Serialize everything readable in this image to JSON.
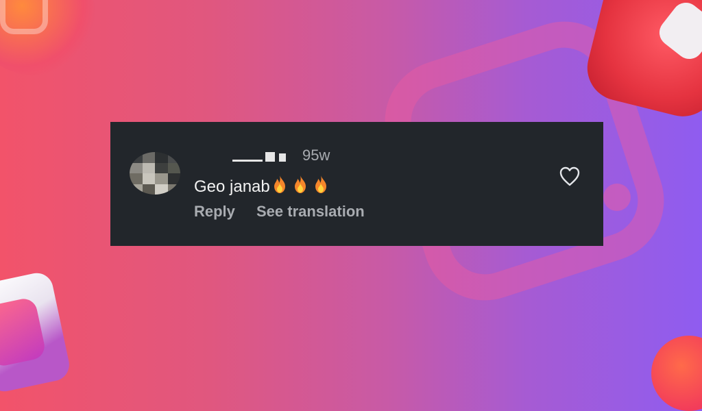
{
  "comment": {
    "username_blurred": true,
    "timestamp": "95w",
    "text": "Geo janab",
    "emojis": [
      "fire-icon",
      "fire-icon",
      "fire-icon"
    ],
    "reply_label": "Reply",
    "translate_label": "See translation",
    "like_icon": "heart-outline-icon"
  },
  "colors": {
    "card_background": "#22262b",
    "primary_text": "#f2f2f2",
    "secondary_text": "#a9acb1",
    "background_gradient": [
      "#f2536a",
      "#c85aa6",
      "#8f5cf0"
    ]
  }
}
